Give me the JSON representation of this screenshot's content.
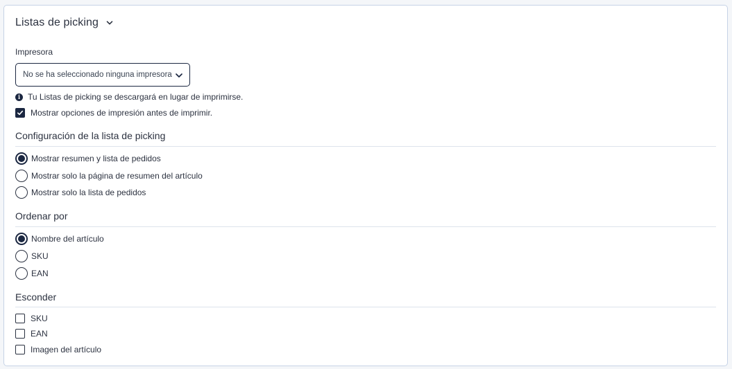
{
  "header": {
    "title": "Listas de picking"
  },
  "printer": {
    "label": "Impresora",
    "selected": "No se ha seleccionado ninguna impresora",
    "info": "Tu Listas de picking se descargará en lugar de imprimirse.",
    "show_options_label": "Mostrar opciones de impresión antes de imprimir.",
    "show_options_checked": true
  },
  "config": {
    "title": "Configuración de la lista de picking",
    "options": [
      {
        "label": "Mostrar resumen y lista de pedidos",
        "checked": true
      },
      {
        "label": "Mostrar solo la página de resumen del artículo",
        "checked": false
      },
      {
        "label": "Mostrar solo la lista de pedidos",
        "checked": false
      }
    ]
  },
  "sort": {
    "title": "Ordenar por",
    "options": [
      {
        "label": "Nombre del artículo",
        "checked": true
      },
      {
        "label": "SKU",
        "checked": false
      },
      {
        "label": "EAN",
        "checked": false
      }
    ]
  },
  "hide": {
    "title": "Esconder",
    "options": [
      {
        "label": "SKU",
        "checked": false
      },
      {
        "label": "EAN",
        "checked": false
      },
      {
        "label": "Imagen del artículo",
        "checked": false
      }
    ]
  },
  "colors": {
    "accent": "#1b2741",
    "border": "#c6d3e6",
    "divider": "#dde3ec"
  },
  "icons": {
    "header_toggle": "chevron-down-icon",
    "select_arrow": "chevron-down-icon",
    "info": "info-icon",
    "check": "checkmark-icon"
  }
}
